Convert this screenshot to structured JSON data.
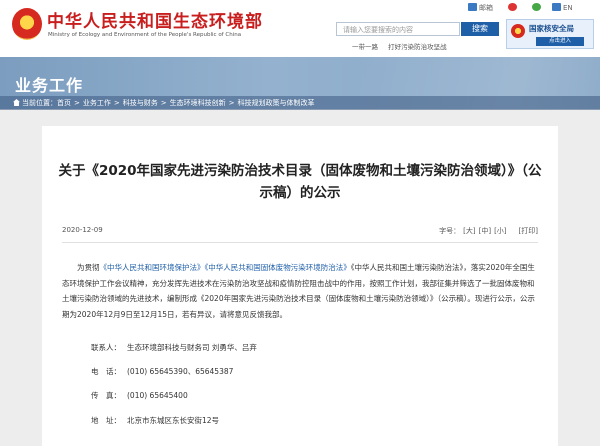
{
  "header": {
    "site_title": "中华人民共和国生态环境部",
    "site_subtitle": "Ministry of Ecology and Environment of the People's Republic of China",
    "search_placeholder": "请输入您要搜索的内容",
    "search_button": "搜索",
    "top_links": {
      "mail": "邮箱",
      "en": "EN"
    },
    "quick_links": [
      "一带一路",
      "打好污染防治攻坚战"
    ],
    "nsa": {
      "title": "国家核安全局",
      "button": "点击进入"
    }
  },
  "banner": {
    "title": "业务工作",
    "breadcrumb_prefix": "当前位置：",
    "breadcrumb": [
      "首页",
      "业务工作",
      "科技与财务",
      "生态环境科技创新",
      "科技规划政策与体制改革"
    ],
    "breadcrumb_sep": ">"
  },
  "article": {
    "title": "关于《2020年国家先进污染防治技术目录（固体废物和土壤污染防治领域）》（公示稿）的公示",
    "date": "2020-12-09",
    "font_label": "字号：",
    "font_sizes": [
      "[大]",
      "[中]",
      "[小]"
    ],
    "print": "[打印]",
    "body_intro": "为贯彻",
    "law1": "《中华人民共和国环境保护法》",
    "law2": "《中华人民共和国固体废物污染环境防治法》",
    "body_rest": "《中华人民共和国土壤污染防治法》，落实2020年全国生态环境保护工作会议精神，充分发挥先进技术在污染防治攻坚战和疫情防控阻击战中的作用，按照工作计划，我部征集并筛选了一批固体废物和土壤污染防治领域的先进技术，编制形成《2020年国家先进污染防治技术目录（固体废物和土壤污染防治领域）》（公示稿）。现进行公示，公示期为2020年12月9日至12月15日，若有异议，请将意见反馈我部。",
    "contacts": [
      {
        "label": "联系人：",
        "value": "生态环境部科技与财务司 刘勇华、吕弃"
      },
      {
        "label": "电　话：",
        "value": "(010) 65645390、65645387"
      },
      {
        "label": "传　真：",
        "value": "(010) 65645400"
      },
      {
        "label": "地　址：",
        "value": "北京市东城区东长安街12号"
      }
    ]
  },
  "colors": {
    "brand_red": "#c81e1e",
    "link_blue": "#1f5fa8",
    "banner_blue": "#86a6c6"
  }
}
